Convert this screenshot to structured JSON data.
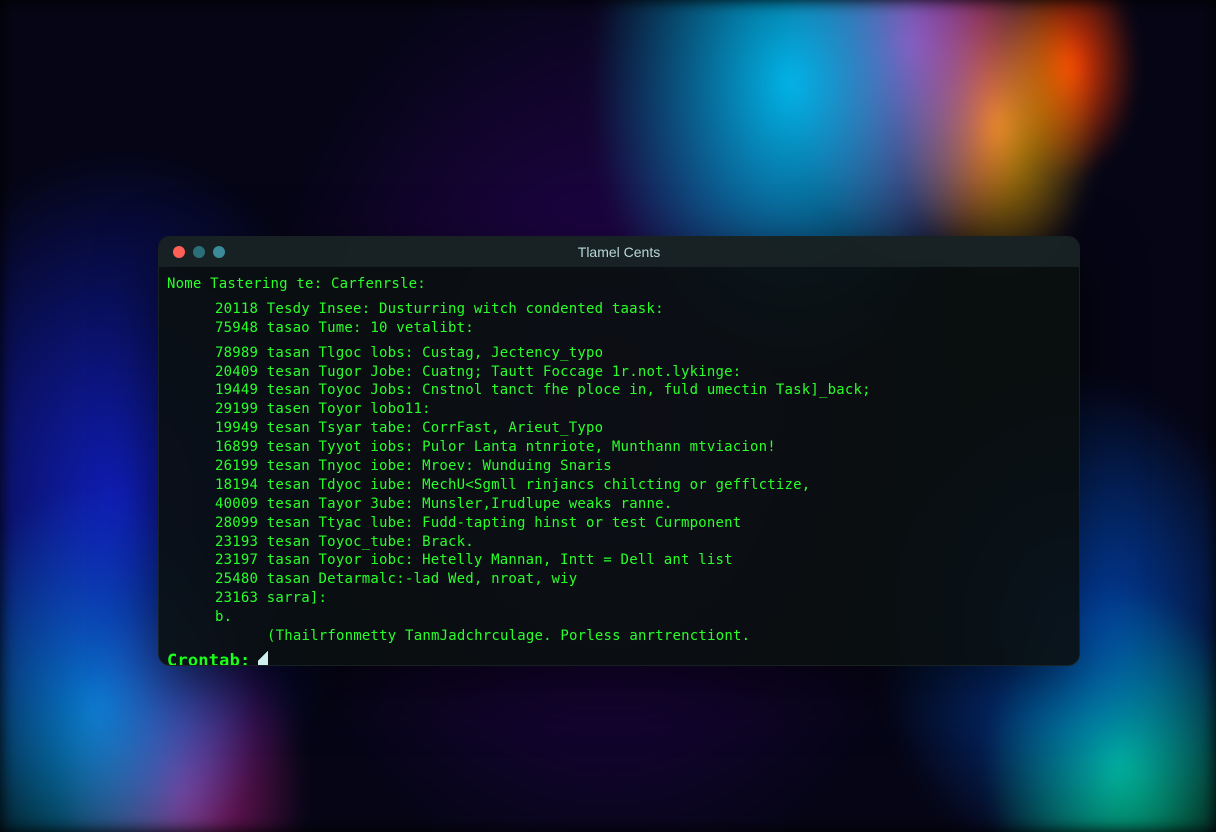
{
  "window": {
    "title": "Tlamel Cents"
  },
  "header": {
    "line": "Nome Tastering te: Carfenrsle:"
  },
  "intro": [
    "20118 Tesdy Insee: Dusturring witch condented taask:",
    "75948 tasao Tume: 10 vetalibt:"
  ],
  "logs": [
    {
      "id": "78989",
      "tag": "tasan Tlgoc lobs:",
      "msg": "Custag, Jectency_typo"
    },
    {
      "id": "20409",
      "tag": "tesan Tugor Jobe:",
      "msg": "Cuatng; Tautt Foccage 1r.not.lykinge:"
    },
    {
      "id": "19449",
      "tag": "tesan Toyoc Jobs:",
      "msg": "Cnstnol tanct fhe ploce in, fuld umectin Task]_back;"
    },
    {
      "id": "29199",
      "tag": "tasen Toyor lobo11:",
      "msg": ""
    },
    {
      "id": "19949",
      "tag": "tesan Tsyar tabe:",
      "msg": "CorrFast, Arieut_Typo"
    },
    {
      "id": "16899",
      "tag": "tesan Tyyot iobs:",
      "msg": "Pulor Lanta ntnriote, Munthann mtviacion!"
    },
    {
      "id": "26199",
      "tag": "tesan Tnyoc iobe:",
      "msg": "Mroev: Wunduing Snaris"
    },
    {
      "id": "18194",
      "tag": "tesan Tdyoc iube:",
      "msg": "MechU<Sgmll rinjancs chilcting or gefflctize,"
    },
    {
      "id": "40009",
      "tag": "tesan Tayor 3ube:",
      "msg": "Munsler,Irudlupe weaks ranne."
    },
    {
      "id": "28099",
      "tag": "tesan Ttyac lube:",
      "msg": "Fudd-tapting hinst or test Curmponent"
    },
    {
      "id": "23193",
      "tag": "tesan Toyoc_tube:",
      "msg": "Brack."
    },
    {
      "id": "23197",
      "tag": "tasan Toyor iobc:",
      "msg": "Hetelly Mannan, Intt = Dell ant list"
    },
    {
      "id": "25480",
      "tag": "tasan",
      "msg": "Detarmalc:-lad Wed, nroat, wiy"
    },
    {
      "id": "23163",
      "tag": "sarra]:",
      "msg": ""
    }
  ],
  "tail": "b.",
  "footnote": "(Thailrfonmetty TanmJadchrculage. Porless anrtrenctiont.",
  "prompt": {
    "label": "Crontab:"
  }
}
